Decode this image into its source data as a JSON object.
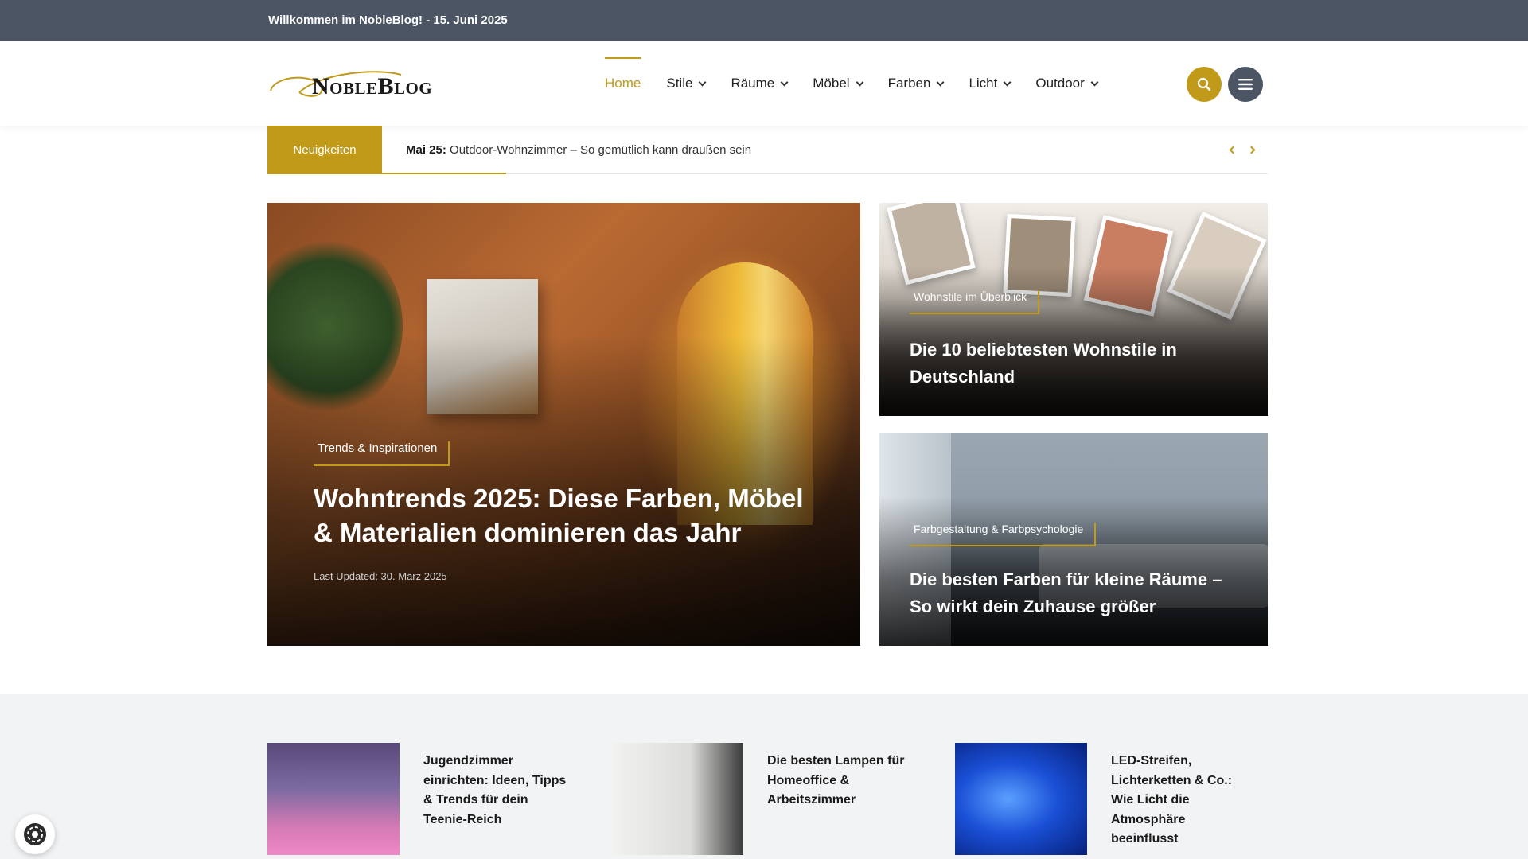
{
  "topbar": {
    "welcome": "Willkommen im NobleBlog! - 15. Juni 2025"
  },
  "header": {
    "logo_text": "NobleBlog",
    "nav": [
      {
        "label": "Home",
        "active": true,
        "dropdown": false
      },
      {
        "label": "Stile",
        "active": false,
        "dropdown": true
      },
      {
        "label": "Räume",
        "active": false,
        "dropdown": true
      },
      {
        "label": "Möbel",
        "active": false,
        "dropdown": true
      },
      {
        "label": "Farben",
        "active": false,
        "dropdown": true
      },
      {
        "label": "Licht",
        "active": false,
        "dropdown": true
      },
      {
        "label": "Outdoor",
        "active": false,
        "dropdown": true
      }
    ],
    "search_icon": "search-icon",
    "menu_icon": "hamburger-menu-icon"
  },
  "ticker": {
    "label": "Neuigkeiten",
    "date": "Mai 25:",
    "headline": "Outdoor-Wohnzimmer – So gemütlich kann draußen sein"
  },
  "featured": {
    "main": {
      "category": "Trends & Inspirationen",
      "title": "Wohntrends 2025: Diese Farben, Möbel & Materialien dominieren das Jahr",
      "meta": "Last Updated: 30. März 2025"
    },
    "side": [
      {
        "category": "Wohnstile im Überblick",
        "title": "Die 10 beliebtesten Wohnstile in Deutschland"
      },
      {
        "category": "Farbgestaltung & Farbpsychologie",
        "title": "Die besten Farben für kleine Räume – So wirkt dein Zuhause größer"
      }
    ]
  },
  "mini_posts": [
    {
      "title": "Jugendzimmer einrichten: Ideen, Tipps & Trends für dein Teenie-Reich"
    },
    {
      "title": "Die besten Lampen für Homeoffice & Arbeitszimmer"
    },
    {
      "title": "LED-Streifen, Lichterketten & Co.: Wie Licht die Atmosphäre beeinflusst"
    }
  ],
  "colors": {
    "accent": "#c19a1a",
    "topbar": "#4b5563",
    "section_bg": "#f1f3f5"
  }
}
